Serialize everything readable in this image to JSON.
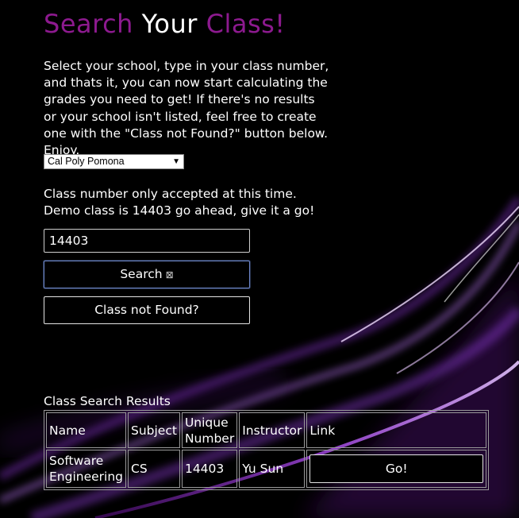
{
  "title": {
    "part1": "Search",
    "part2": "Your",
    "part3": "Class!"
  },
  "intro_text": "Select your school, type in your class number, and thats it, you can now start calculating the grades you need to get! If there's no results or your school isn't listed, feel free to create one with the \"Class not Found?\" button below. Enjoy.",
  "school_select": {
    "selected": "Cal Poly Pomona",
    "caret_icon": "chevron-down-icon"
  },
  "hint_text": "Class number only accepted at this time. Demo class is 14403 go ahead, give it a go!",
  "class_input": {
    "value": "14403"
  },
  "buttons": {
    "search_label": "Search",
    "search_icon": "⊠",
    "class_not_found_label": "Class not Found?"
  },
  "results": {
    "caption": "Class Search Results",
    "headers": {
      "name": "Name",
      "subject": "Subject",
      "unique_number": "Unique Number",
      "instructor": "Instructor",
      "link": "Link"
    },
    "rows": [
      {
        "name": "Software Engineering",
        "subject": "CS",
        "unique_number": "14403",
        "instructor": "Yu Sun",
        "link_label": "Go!"
      }
    ]
  },
  "colors": {
    "accent": "#8d1a8f",
    "background": "#000000",
    "text": "#ffffff"
  }
}
